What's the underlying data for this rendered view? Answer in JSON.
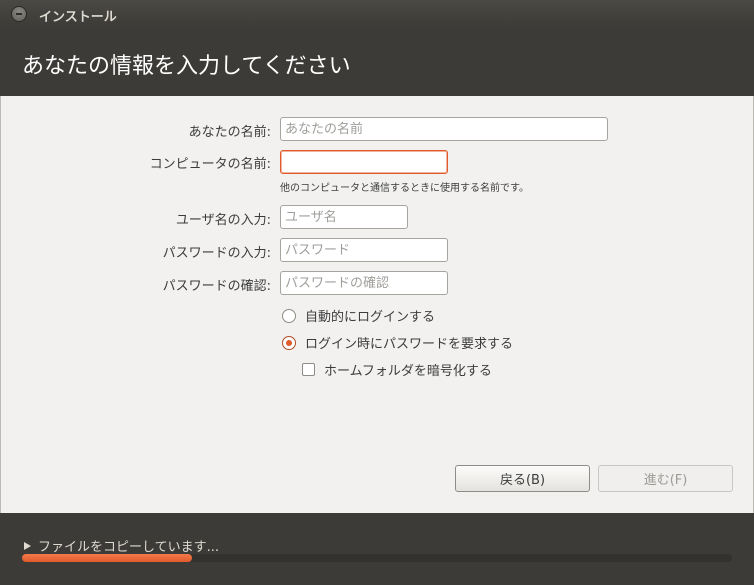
{
  "window": {
    "title": "インストール"
  },
  "header": {
    "title": "あなたの情報を入力してください"
  },
  "form": {
    "name": {
      "label": "あなたの名前:",
      "value": "",
      "placeholder": "あなたの名前"
    },
    "computer": {
      "label": "コンピュータの名前:",
      "value": "",
      "placeholder": "",
      "hint": "他のコンピュータと通信するときに使用する名前です。"
    },
    "username": {
      "label": "ユーザ名の入力:",
      "value": "",
      "placeholder": "ユーザ名"
    },
    "password": {
      "label": "パスワードの入力:",
      "value": "",
      "placeholder": "パスワード"
    },
    "confirm": {
      "label": "パスワードの確認:",
      "value": "",
      "placeholder": "パスワードの確認"
    },
    "options": {
      "auto_login": {
        "label": "自動的にログインする",
        "checked": false
      },
      "require_password": {
        "label": "ログイン時にパスワードを要求する",
        "checked": true
      },
      "encrypt_home": {
        "label": "ホームフォルダを暗号化する",
        "checked": false
      }
    }
  },
  "buttons": {
    "back": "戻る(B)",
    "next": "進む(F)"
  },
  "footer": {
    "status": "ファイルをコピーしています...",
    "progress": 0.24
  },
  "colors": {
    "accent": "#e15a2c",
    "dark": "#3c3b37",
    "background": "#f2f1f0"
  }
}
